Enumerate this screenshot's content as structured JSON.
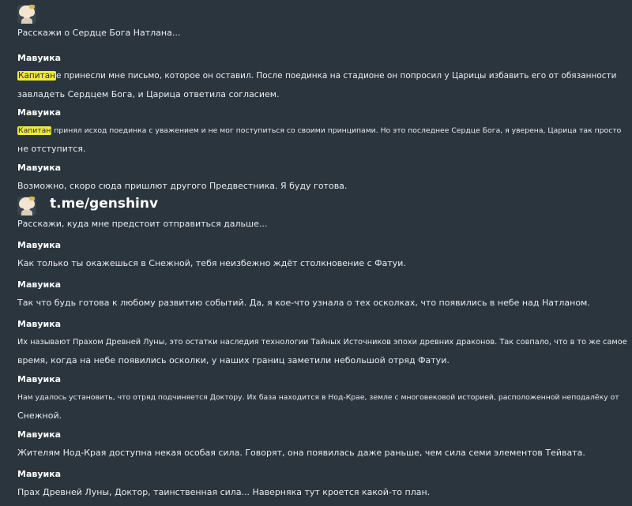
{
  "watermark": "t.me/genshinv",
  "dialogs": {
    "prompt1": "Расскажи о Сердце Бога Натлана...",
    "m1": {
      "speaker": "Мавуика",
      "hl": "Капитан",
      "rest": "е принесли мне письмо, которое он оставил. После поединка на стадионе он попросил у Царицы избавить его от обязанности",
      "line2": "завладеть Сердцем Бога, и Царица ответила согласием."
    },
    "m2": {
      "speaker": "Мавуика",
      "hl": "Капитан",
      "rest": " принял исход поединка с уважением и не мог поступиться со своими принципами. Но это последнее Сердце Бога, я уверена, Царица так просто",
      "line2": "не отступится."
    },
    "m3": {
      "speaker": "Мавуика",
      "line1": "Возможно, скоро сюда пришлют другого Предвестника. Я буду готова."
    },
    "prompt2": "Расскажи, куда мне предстоит отправиться дальше...",
    "m4": {
      "speaker": "Мавуика",
      "line1": "Как только ты окажешься в Снежной, тебя неизбежно ждёт столкновение с Фатуи."
    },
    "m5": {
      "speaker": "Мавуика",
      "line1": "Так что будь готова к любому развитию событий. Да, я кое-что узнала о тех осколках, что появились в небе над Натланом."
    },
    "m6": {
      "speaker": "Мавуика",
      "line1": "Их называют Прахом Древней Луны, это остатки наследия технологии Тайных Источников эпохи древних драконов. Так совпало, что в то же самое",
      "line2": "время, когда на небе появились осколки, у наших границ заметили небольшой отряд Фатуи."
    },
    "m7": {
      "speaker": "Мавуика",
      "line1": "Нам удалось установить, что отряд подчиняется Доктору. Их база находится в Нод-Крае, земле с многовековой историей, расположенной неподалёку от",
      "line2": "Снежной."
    },
    "m8": {
      "speaker": "Мавуика",
      "line1": "Жителям Нод-Края доступна некая особая сила. Говорят, она появилась даже раньше, чем сила семи элементов Тейвата."
    },
    "m9": {
      "speaker": "Мавуика",
      "line1": "Прах Древней Луны, Доктор, таинственная сила... Наверняка тут кроется какой-то план."
    }
  }
}
